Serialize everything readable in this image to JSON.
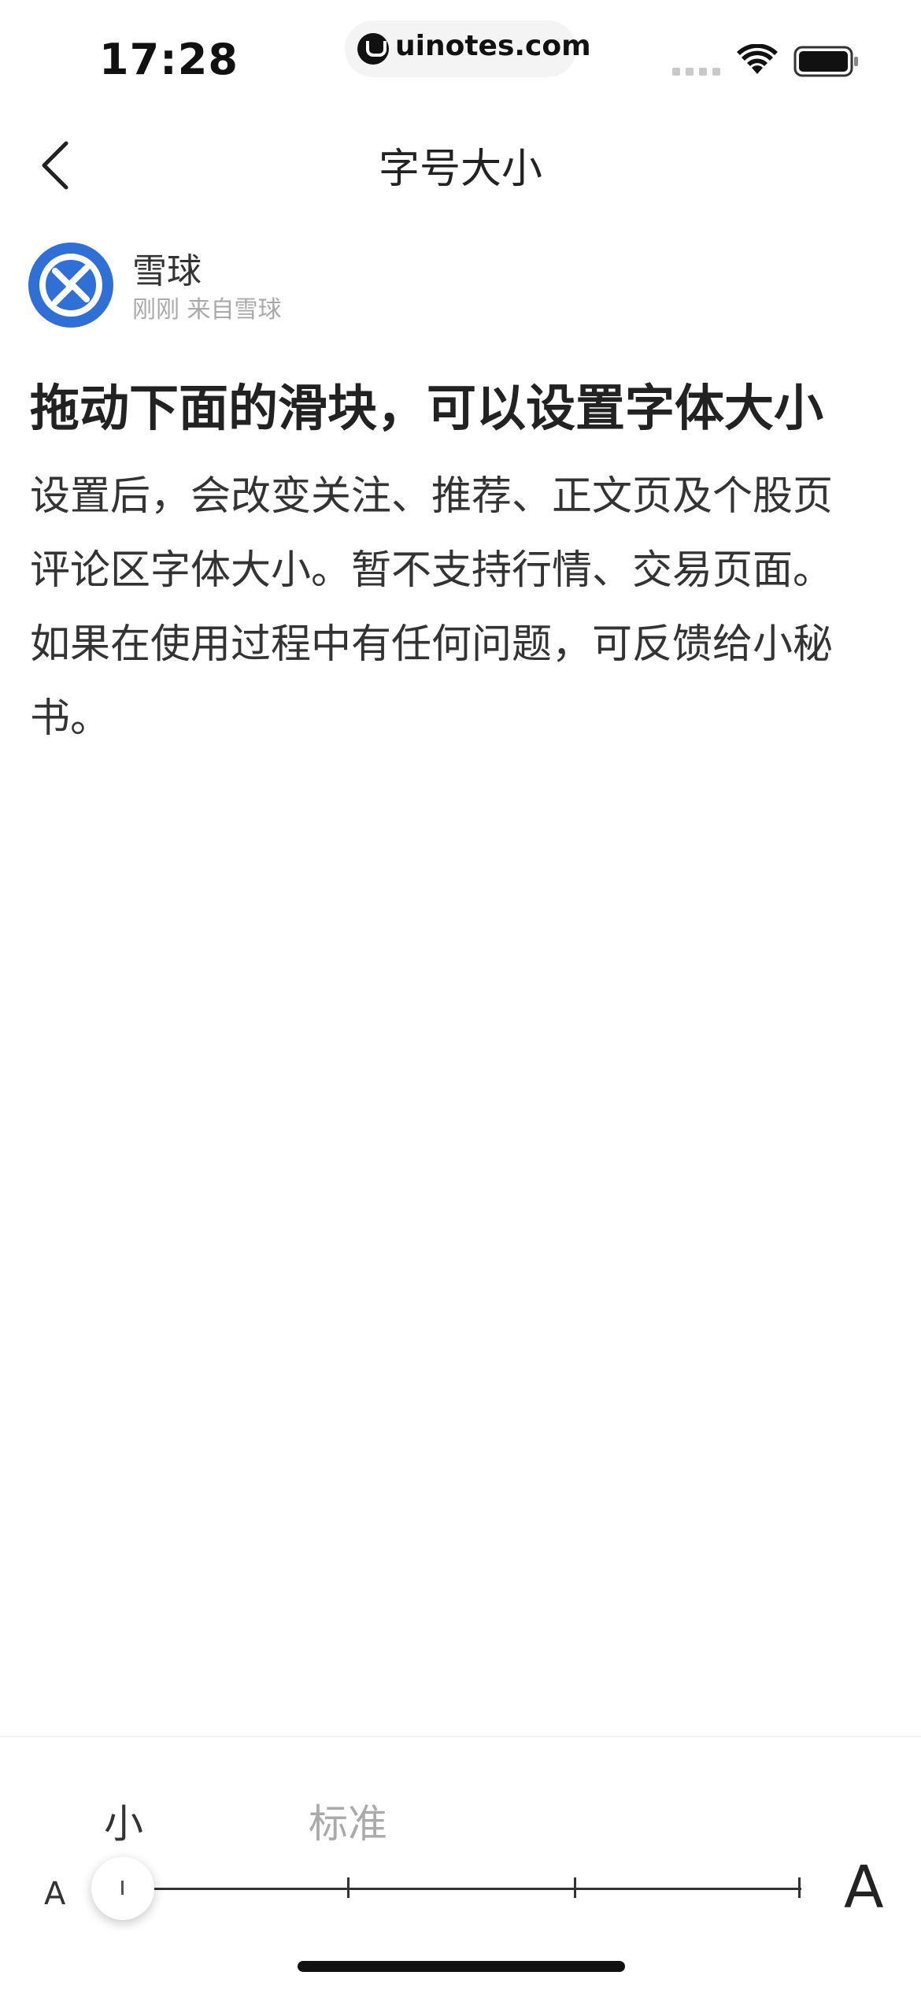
{
  "status_bar": {
    "time": "17:28",
    "url": "uinotes.com"
  },
  "nav": {
    "title": "字号大小",
    "back_icon": "chevron-left-icon"
  },
  "post": {
    "author": "雪球",
    "meta": "刚刚 来自雪球",
    "headline": "拖动下面的滑块，可以设置字体大小",
    "body": "设置后，会改变关注、推荐、正文页及个股页评论区字体大小。暂不支持行情、交易页面。如果在使用过程中有任何问题，可反馈给小秘书。"
  },
  "font_slider": {
    "labels": [
      "小",
      "标准"
    ],
    "min_label": "A",
    "max_label": "A",
    "steps": 4,
    "selected_index": 0
  },
  "colors": {
    "brand_blue": "#2f6fd6",
    "text_primary": "#222222",
    "text_muted": "#aaaaaa"
  }
}
